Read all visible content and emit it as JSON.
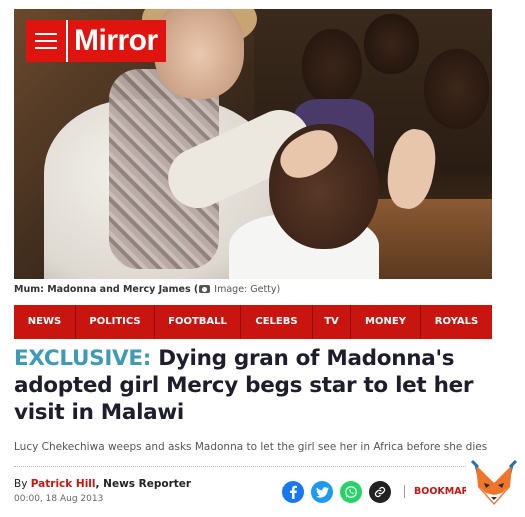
{
  "logo": {
    "wordmark": "Mirror",
    "menu_icon": "hamburger-icon"
  },
  "photo": {
    "caption": "Mum: Madonna and Mercy James (",
    "credit_icon": "camera-icon",
    "credit": "Image: Getty)"
  },
  "nav": {
    "items": [
      {
        "label": "NEWS"
      },
      {
        "label": "POLITICS"
      },
      {
        "label": "FOOTBALL"
      },
      {
        "label": "CELEBS"
      },
      {
        "label": "TV"
      },
      {
        "label": "MONEY"
      },
      {
        "label": "ROYALS"
      }
    ]
  },
  "article": {
    "exclusive_tag": "EXCLUSIVE:",
    "headline": " Dying gran of Madonna's adopted girl Mercy begs star to let her visit in Malawi",
    "standfirst": "Lucy Chekechiwa weeps and asks Madonna to let the girl see her in Africa before she dies",
    "byline_prefix": "By ",
    "author": "Patrick Hill",
    "role": ", News Reporter",
    "date": "00:00, 18 Aug 2013",
    "bookmark_label": "BOOKMARK"
  },
  "share": {
    "icons": [
      "facebook-icon",
      "twitter-icon",
      "whatsapp-icon",
      "link-icon"
    ]
  },
  "colors": {
    "brand_red": "#e0140f",
    "nav_red": "#c91510",
    "exclusive_blue": "#3f9bb5"
  }
}
